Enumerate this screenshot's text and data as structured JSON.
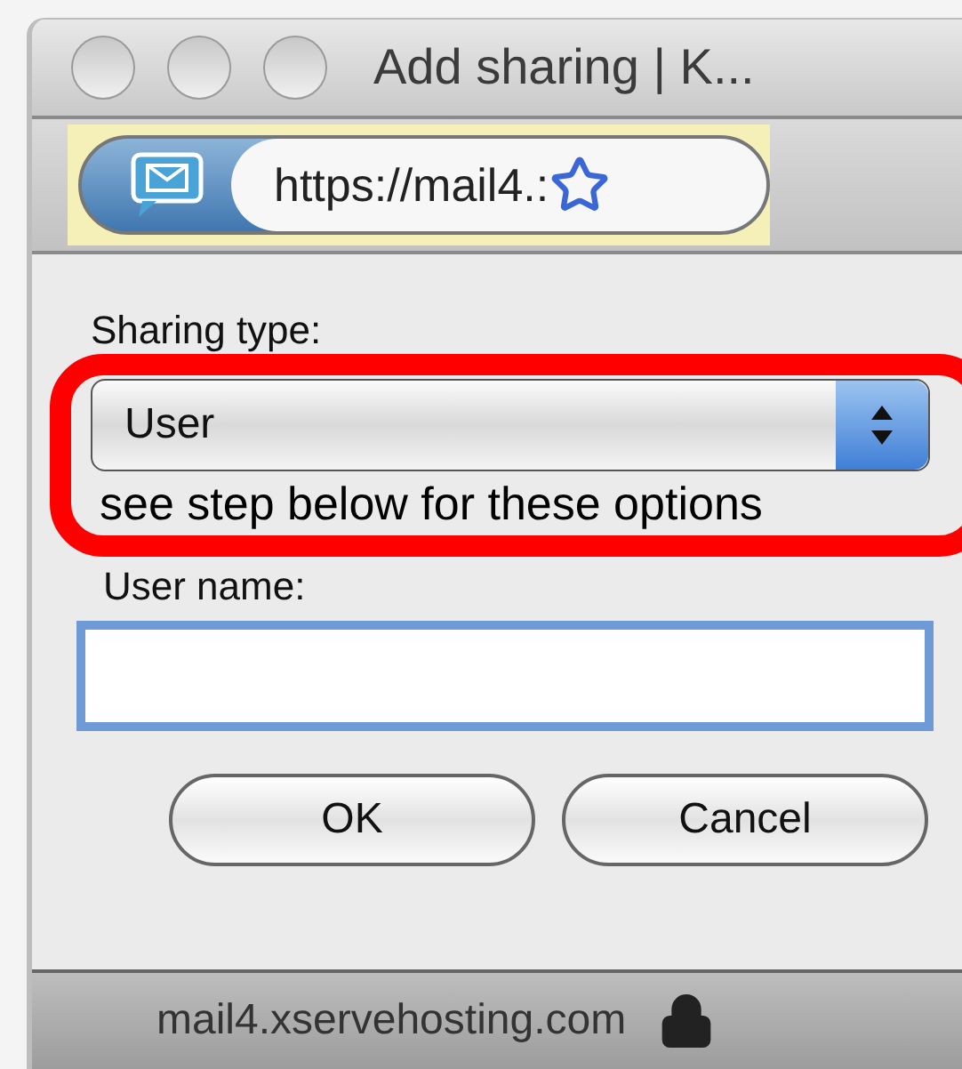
{
  "window": {
    "title": "Add sharing | K..."
  },
  "toolbar": {
    "url": "https://mail4.:"
  },
  "form": {
    "sharing_type_label": "Sharing type:",
    "sharing_type_value": "User",
    "annotation_note": "see step below for these options",
    "user_name_label": "User name:"
  },
  "buttons": [
    "OK",
    "Cancel"
  ],
  "status_bar": {
    "host": "mail4.xservehosting.com"
  }
}
